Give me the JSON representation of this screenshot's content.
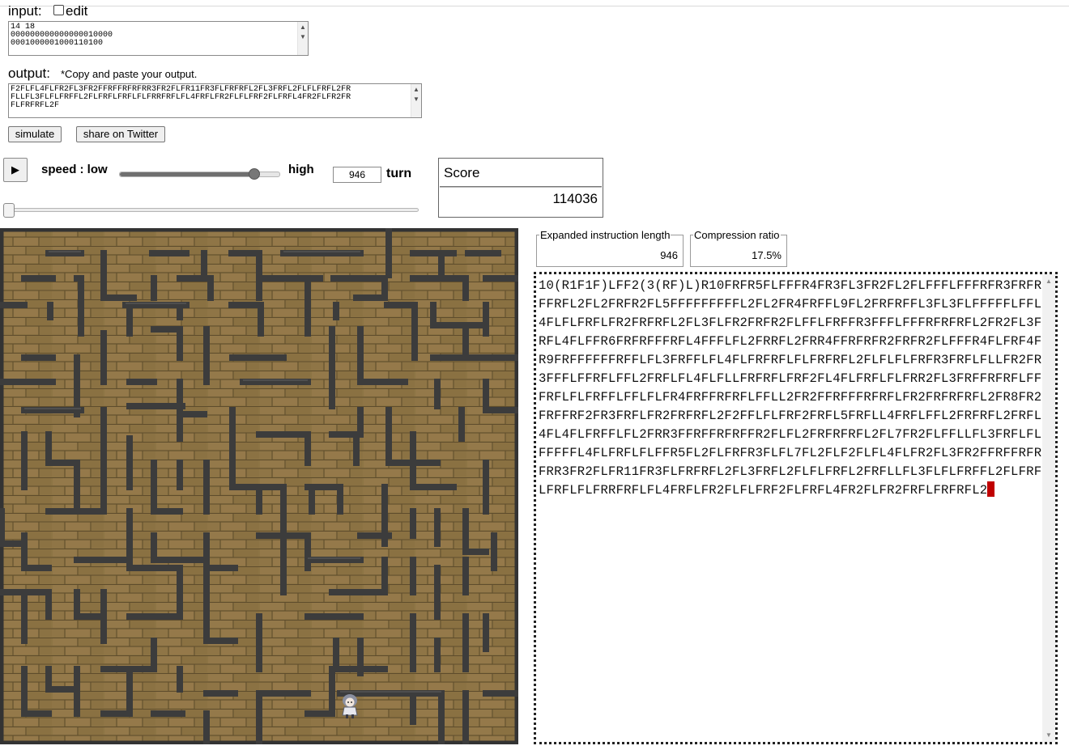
{
  "input": {
    "label": "input:",
    "edit_label": "edit",
    "edit_checked": false,
    "text": "14 18\n000000000000000010000\n0001000001000110100"
  },
  "output": {
    "label": "output:",
    "note": "*Copy and paste your output.",
    "text": "F2FLFL4FLFR2FL3FR2FFRFFRFRFRR3FR2FLFR11FR3FLFRFRFL2FL3FRFL2FLFLFRFL2FR\nFLLFL3FLFLFRFFL2FLFRFLFRFLFLFRRFRFLFL4FRFLFR2FLFLFRF2FLFRFL4FR2FLFR2FR\nFLFRFRFL2F"
  },
  "buttons": {
    "simulate": "simulate",
    "share": "share on Twitter"
  },
  "controls": {
    "play_icon": "play-icon",
    "speed_label": "speed : low",
    "high_label": "high",
    "speed_level": 0.85,
    "turn_value": "946",
    "turn_label": "turn",
    "turn_position": 0.0
  },
  "score": {
    "label": "Score",
    "value": "114036"
  },
  "stats": {
    "expanded_label": "Expanded instruction length",
    "expanded_value": "946",
    "compression_label": "Compression ratio",
    "compression_value": "17.5%"
  },
  "program": "10(R1F1F)LFF2(3(RF)L)R10FRFR5FLFFFR4FR3FL3FR2FL2FLFFFLFFFRFR3FRFRFFRFL2FL2FRFR2FL5FFFFFFFFFL2FL2FR4FRFFL9FL2FRFRFFL3FL3FLFFFFFLFFL4FLFLFRFLFR2FRFRFL2FL3FLFR2FRFR2FLFFLFRFFR3FFFLFFFRFRFRFL2FR2FL3FRFL4FLFFR6FRFRFFFRFL4FFFLFL2FRRFL2FRR4FFRFRFR2FRFR2FLFFFR4FLFRF4FR9FRFFFFFFRFFLFL3FRFFLFL4FLFRFRFLFLFRFRFL2FLFLFLFRFR3FRFLFLLFR2FR3FFFLFFRFLFFL2FRFLFL4FLFLLFRFRFLFRF2FL4FLFRFLFLFRR2FL3FRFFRFRFLFFFRFLFLFRFFLFFLFLFR4FRFFRFRFLFFLL2FR2FFRFFFRFRFLFR2FRFRFRFL2FR8FR2FRFFRF2FR3FRFLFR2FRFRFL2F2FFLFLFRF2FRFL5FRFLL4FRFLFFL2FRFRFL2FRFL4FL4FLFRFFLFL2FRR3FFRFFRFRFFR2FLFL2FRFRFRFL2FL7FR2FLFFLLFL3FRFLFLFFFFFL4FLFRFLFLFFR5FL2FLFRFR3FLFL7FL2FLF2FLFL4FLFR2FL3FR2FFRFFRFRFRR3FR2FLFR11FR3FLFRFRFL2FL3FRFL2FLFLFRFL2FRFLLFL3FLFLFRFFL2FLFRFLFRFLFLFRRFRFLFL4FRFLFR2FLFLFRF2FLFRFL4FR2FLFR2FRFLFRFRFL2",
  "colors": {
    "brick": "#8c7444",
    "wall": "#3c3c3c",
    "caret": "#c00000",
    "border_dark": "#222222"
  }
}
